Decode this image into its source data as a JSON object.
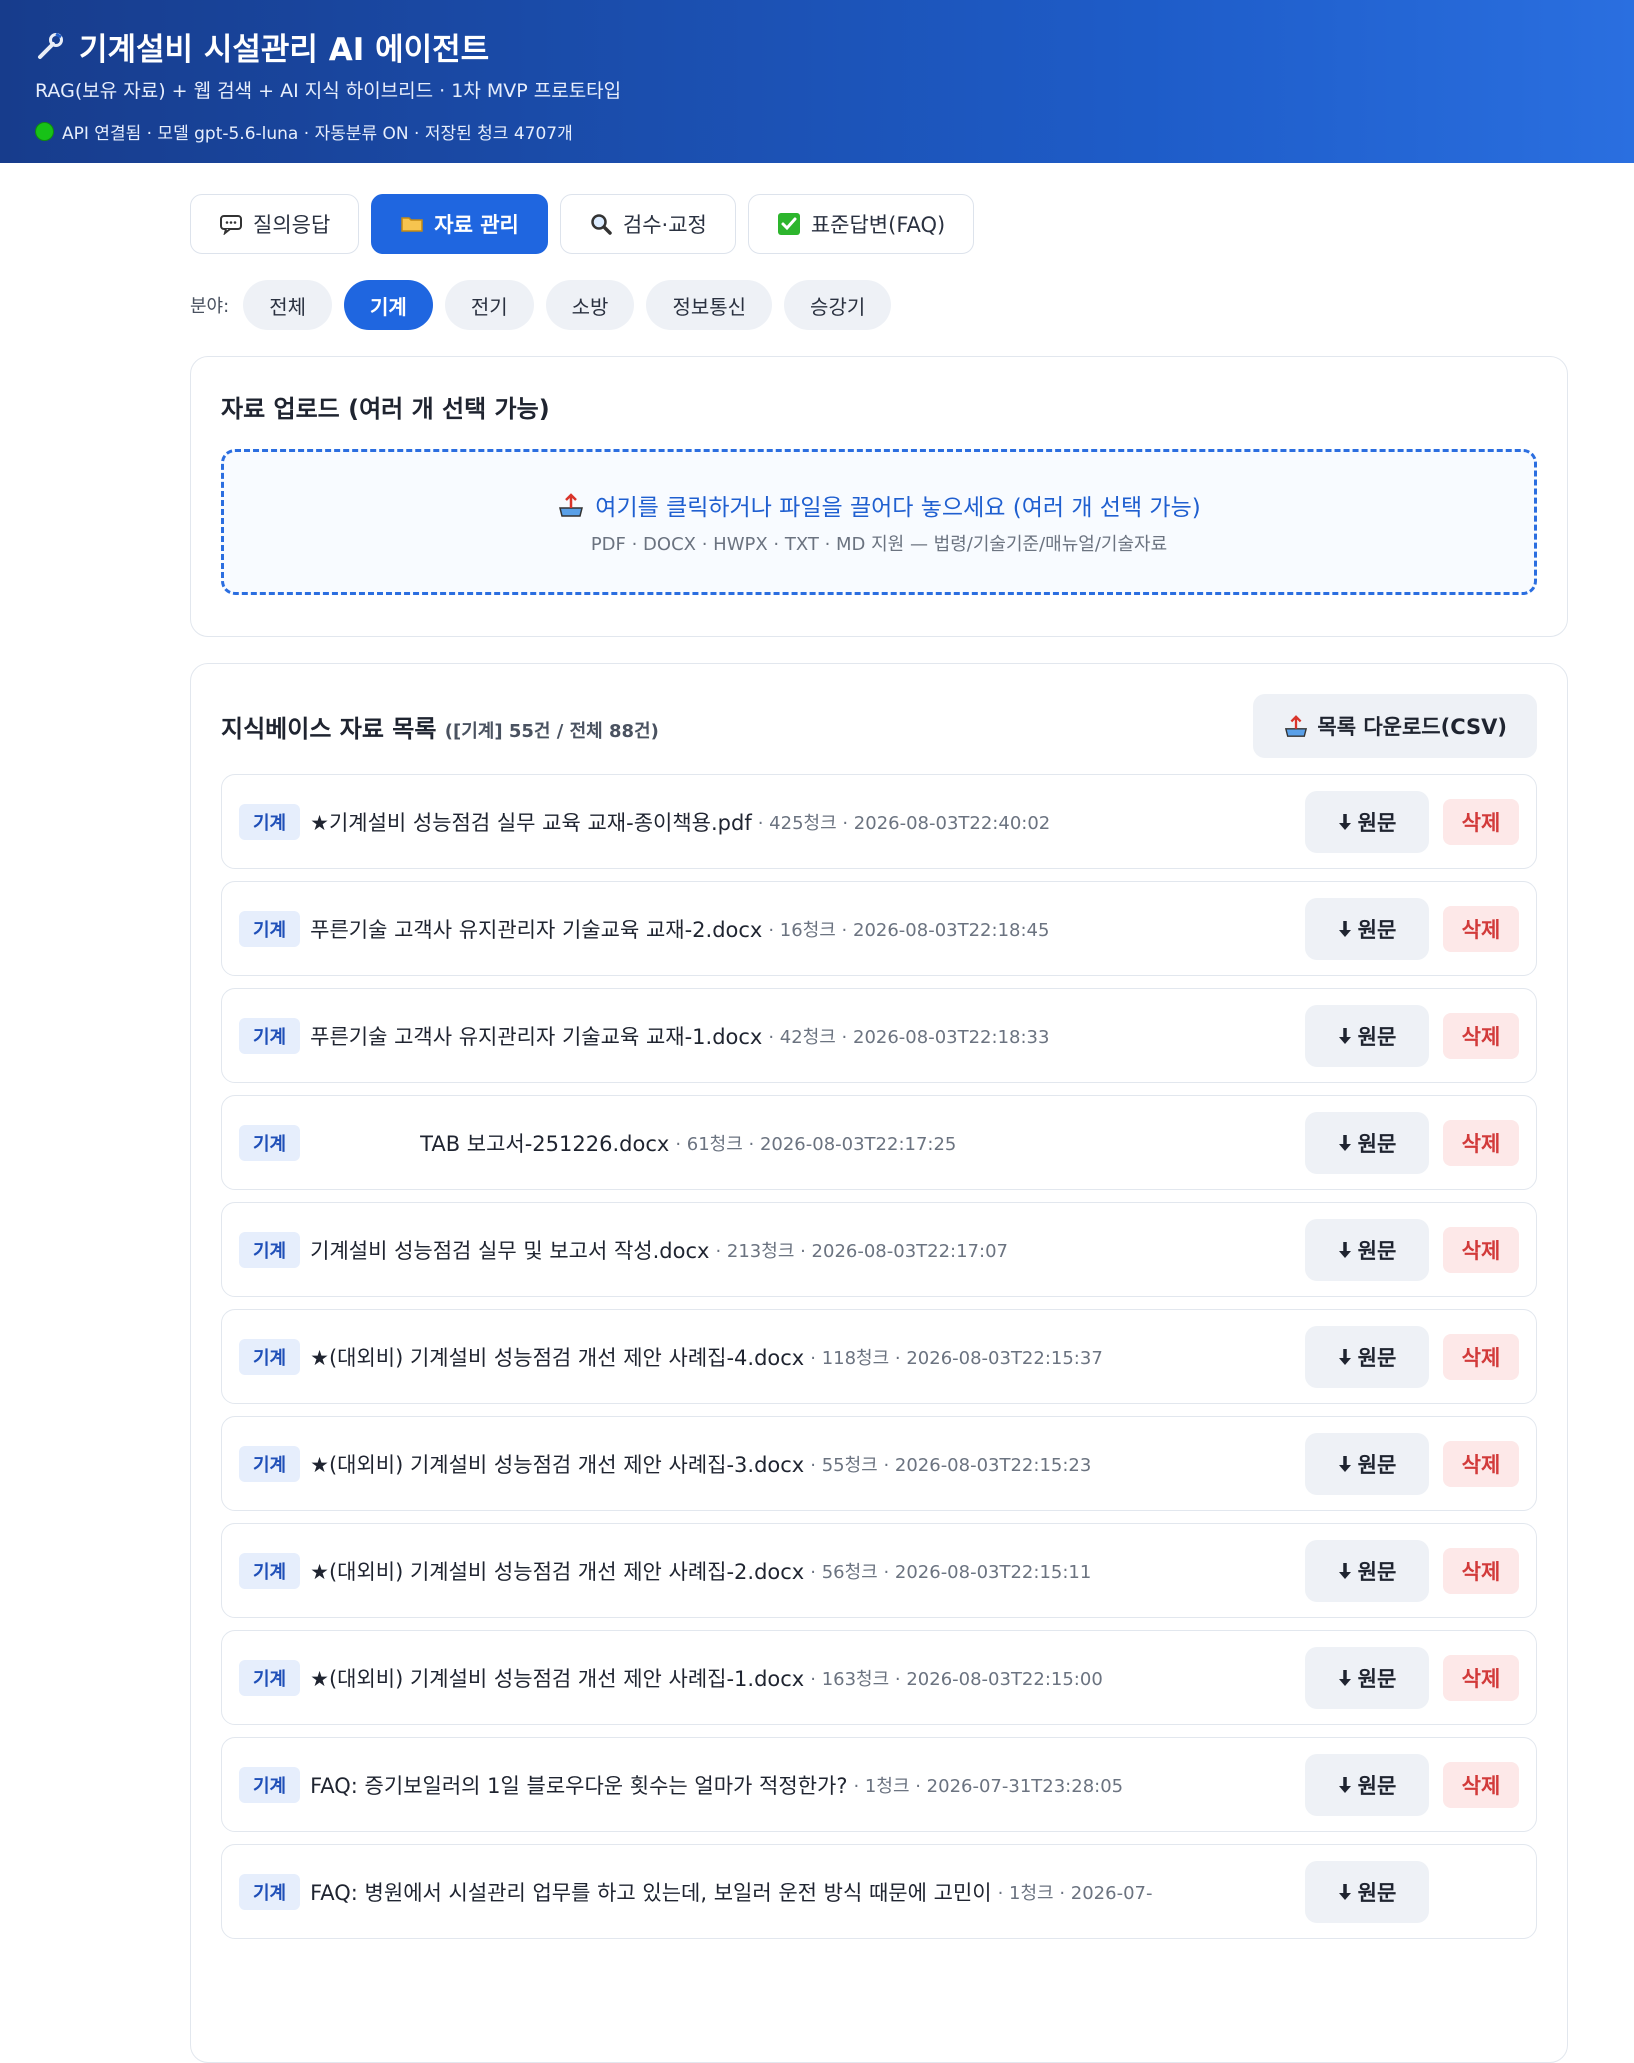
{
  "header": {
    "title": "기계설비 시설관리 AI 에이전트",
    "subtitle": "RAG(보유 자료) + 웹 검색 + AI 지식 하이브리드 · 1차 MVP 프로토타입",
    "status": "API 연결됨 · 모델 gpt-5.6-luna · 자동분류 ON · 저장된 청크 4707개",
    "status_color": "#17c217"
  },
  "tabs": [
    {
      "label": "질의응답",
      "icon": "speech-bubble-icon"
    },
    {
      "label": "자료 관리",
      "icon": "folder-icon"
    },
    {
      "label": "검수·교정",
      "icon": "magnifier-icon"
    },
    {
      "label": "표준답변(FAQ)",
      "icon": "check-box-icon"
    }
  ],
  "fields": {
    "label": "분야:",
    "items": [
      "전체",
      "기계",
      "전기",
      "소방",
      "정보통신",
      "승강기"
    ],
    "selected": "기계"
  },
  "upload": {
    "title": "자료 업로드 (여러 개 선택 가능)",
    "drop_text": "여기를 클릭하거나 파일을 끌어다 놓으세요 (여러 개 선택 가능)",
    "drop_sub": "PDF · DOCX · HWPX · TXT · MD 지원 — 법령/기술기준/매뉴얼/기술자료"
  },
  "list": {
    "title": "지식베이스 자료 목록",
    "count": "([기계] 55건 / 전체 88건)",
    "csv_label": "목록 다운로드(CSV)",
    "download_label": "원문",
    "delete_label": "삭제",
    "rows": [
      {
        "badge": "기계",
        "name": "★기계설비 성능점검 실무 교육 교재-종이책용.pdf",
        "meta": "· 425청크 · 2026-08-03T22:40:02"
      },
      {
        "badge": "기계",
        "name": "푸른기술 고객사 유지관리자 기술교육 교재-2.docx",
        "meta": "· 16청크 · 2026-08-03T22:18:45"
      },
      {
        "badge": "기계",
        "name": "푸른기술 고객사 유지관리자 기술교육 교재-1.docx",
        "meta": "· 42청크 · 2026-08-03T22:18:33"
      },
      {
        "badge": "기계",
        "name": "TAB 보고서-251226.docx",
        "meta": "· 61청크 · 2026-08-03T22:17:25",
        "indent": true
      },
      {
        "badge": "기계",
        "name": "기계설비 성능점검 실무 및 보고서 작성.docx",
        "meta": "· 213청크 · 2026-08-03T22:17:07"
      },
      {
        "badge": "기계",
        "name": "★(대외비) 기계설비 성능점검 개선 제안 사례집-4.docx",
        "meta": "· 118청크 · 2026-08-03T22:15:37"
      },
      {
        "badge": "기계",
        "name": "★(대외비) 기계설비 성능점검 개선 제안 사례집-3.docx",
        "meta": "· 55청크 · 2026-08-03T22:15:23"
      },
      {
        "badge": "기계",
        "name": "★(대외비) 기계설비 성능점검 개선 제안 사례집-2.docx",
        "meta": "· 56청크 · 2026-08-03T22:15:11"
      },
      {
        "badge": "기계",
        "name": "★(대외비) 기계설비 성능점검 개선 제안 사례집-1.docx",
        "meta": "· 163청크 · 2026-08-03T22:15:00"
      },
      {
        "badge": "기계",
        "name": "FAQ: 증기보일러의 1일 블로우다운 횟수는 얼마가 적정한가?",
        "meta": "· 1청크 · 2026-07-31T23:28:05"
      },
      {
        "badge": "기계",
        "name": "FAQ: 병원에서 시설관리 업무를 하고 있는데, 보일러 운전 방식 때문에 고민이",
        "meta": "· 1청크 · 2026-07-"
      }
    ]
  }
}
